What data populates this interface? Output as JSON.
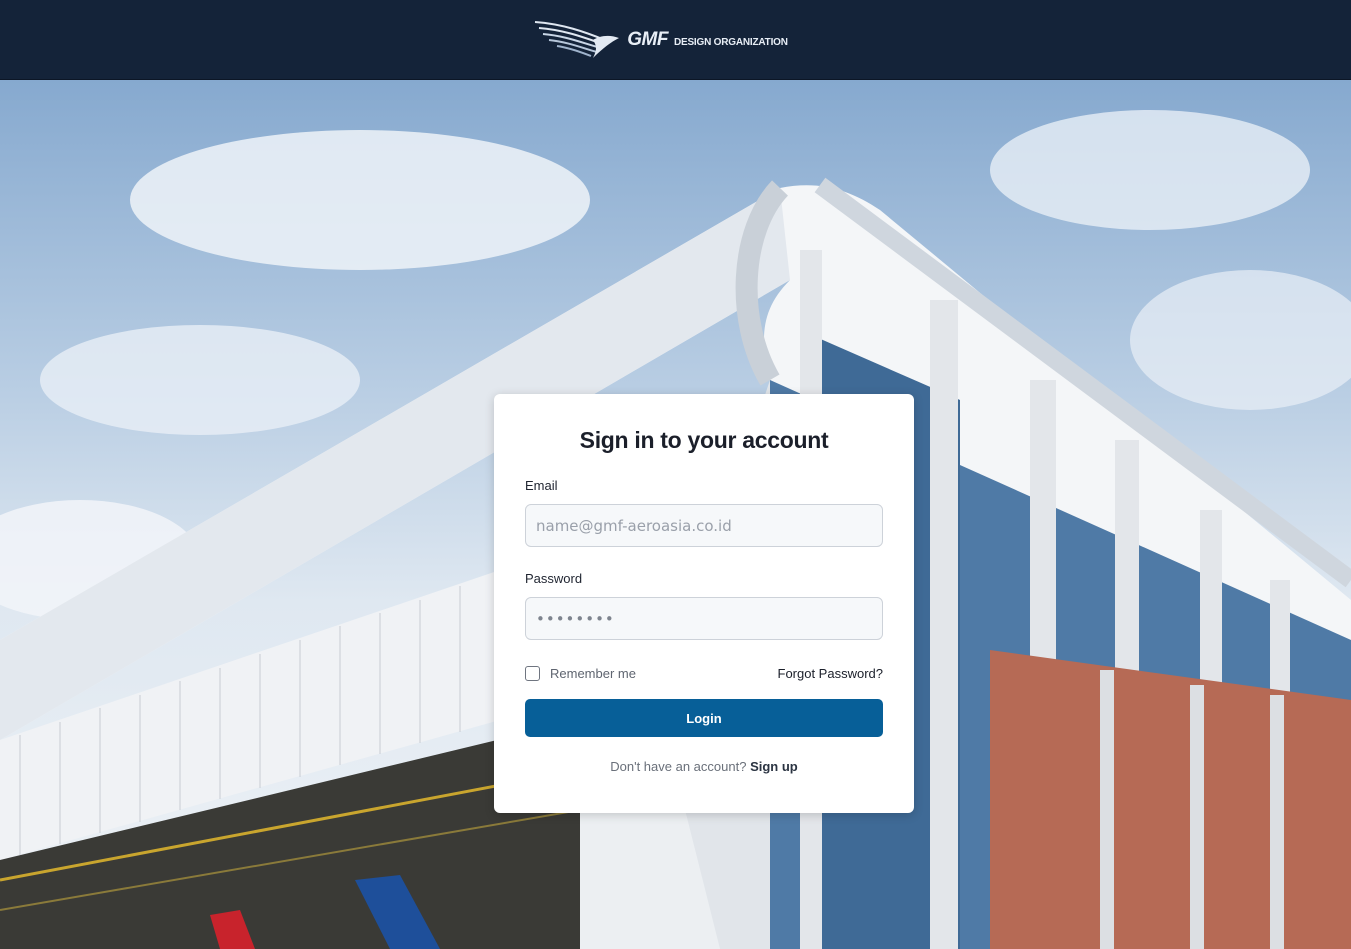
{
  "header": {
    "logo_main": "GMF",
    "logo_sub": "DESIGN ORGANIZATION"
  },
  "login": {
    "title": "Sign in to your account",
    "email_label": "Email",
    "email_placeholder": "name@gmf-aeroasia.co.id",
    "password_label": "Password",
    "password_placeholder": "••••••••",
    "remember_label": "Remember me",
    "forgot_label": "Forgot Password?",
    "login_label": "Login",
    "no_account_text": "Don't have an account?",
    "signup_label": "Sign up"
  },
  "colors": {
    "header_bg": "#142339",
    "primary_button": "#075f98"
  }
}
